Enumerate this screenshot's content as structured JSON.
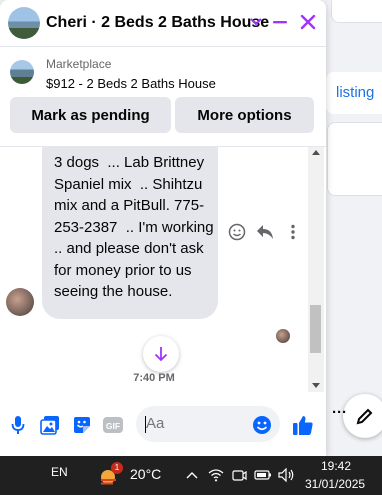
{
  "colors": {
    "accent": "#a033ff",
    "link": "#1b74e4",
    "blue_icon": "#0866ff",
    "bubble": "#e4e6eb"
  },
  "background": {
    "listing_link": "listing"
  },
  "chat": {
    "title": "Cheri · 2 Beds 2 Baths House",
    "marketplace": {
      "label": "Marketplace",
      "listing": "$912 - 2 Beds 2 Baths House",
      "mark_pending": "Mark as pending",
      "more_options": "More options"
    },
    "message": {
      "text": "3 dogs  ... Lab Brittney Spaniel mix  .. Shihtzu mix and a PitBull. 775-253-2387  .. I'm working .. and please don't ask for money prior to us seeing the house."
    },
    "timestamp": "7:40 PM",
    "composer": {
      "placeholder": "Aa",
      "icons": [
        "microphone-icon",
        "photo-icon",
        "sticker-icon",
        "gif-icon",
        "emoji-icon",
        "like-icon"
      ]
    }
  },
  "taskbar": {
    "language": "EN",
    "weather_temp": "20°C",
    "weather_badge": "1",
    "time": "19:42",
    "date": "31/01/2025"
  }
}
